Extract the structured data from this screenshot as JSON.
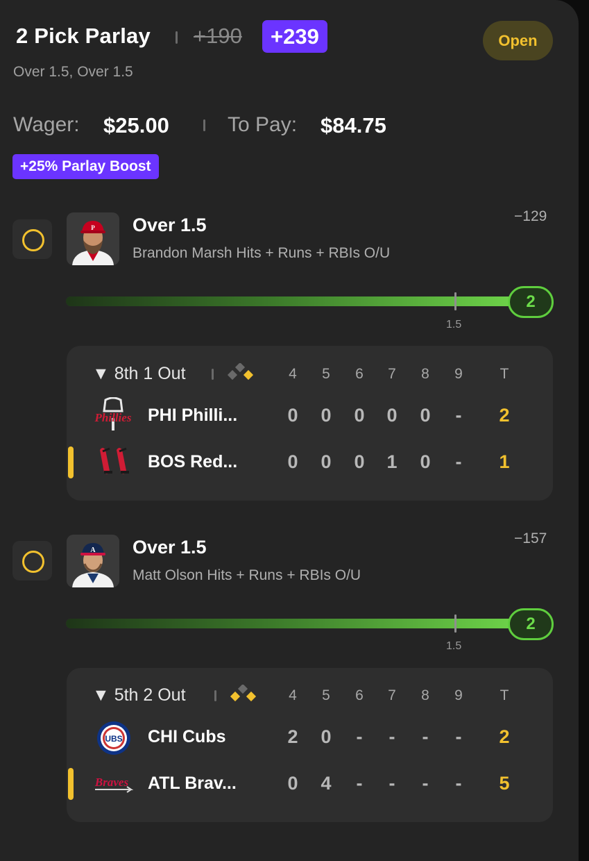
{
  "header": {
    "title": "2 Pick Parlay",
    "old_odds": "+190",
    "boosted_odds": "+239",
    "status": "Open",
    "subtitle": "Over 1.5, Over 1.5"
  },
  "wager": {
    "wager_label": "Wager:",
    "wager_value": "$25.00",
    "pay_label": "To Pay:",
    "pay_value": "$84.75",
    "boost_tag": "+25% Parlay Boost"
  },
  "picks": [
    {
      "title": "Over 1.5",
      "description": "Brandon Marsh Hits + Runs + RBIs O/U",
      "odds": "−129",
      "line_label": "1.5",
      "current_stat": "2",
      "progress_fraction": 1.0,
      "player_icon": "phillies-player-avatar",
      "game": {
        "inning": "▼ 8th 1 Out",
        "columns": [
          "4",
          "5",
          "6",
          "7",
          "8",
          "9",
          "T"
        ],
        "teams": [
          {
            "name": "PHI Philli...",
            "logo": "phillies-logo",
            "scores": [
              "0",
              "0",
              "0",
              "0",
              "0",
              "-"
            ],
            "total": "2",
            "batting": false
          },
          {
            "name": "BOS Red...",
            "logo": "red-sox-logo",
            "scores": [
              "0",
              "0",
              "0",
              "1",
              "0",
              "-"
            ],
            "total": "1",
            "batting": true
          }
        ]
      }
    },
    {
      "title": "Over 1.5",
      "description": "Matt Olson Hits + Runs + RBIs O/U",
      "odds": "−157",
      "line_label": "1.5",
      "current_stat": "2",
      "progress_fraction": 1.0,
      "player_icon": "braves-player-avatar",
      "game": {
        "inning": "▼ 5th 2 Out",
        "columns": [
          "4",
          "5",
          "6",
          "7",
          "8",
          "9",
          "T"
        ],
        "teams": [
          {
            "name": "CHI Cubs",
            "logo": "cubs-logo",
            "scores": [
              "2",
              "0",
              "-",
              "-",
              "-",
              "-"
            ],
            "total": "2",
            "batting": false
          },
          {
            "name": "ATL Brav...",
            "logo": "braves-logo",
            "scores": [
              "0",
              "4",
              "-",
              "-",
              "-",
              "-"
            ],
            "total": "5",
            "batting": true
          }
        ]
      }
    }
  ],
  "colors": {
    "accent_purple": "#6b34ff",
    "status_yellow": "#f2c12e",
    "progress_green": "#6fd64a",
    "card_bg": "#242424"
  }
}
